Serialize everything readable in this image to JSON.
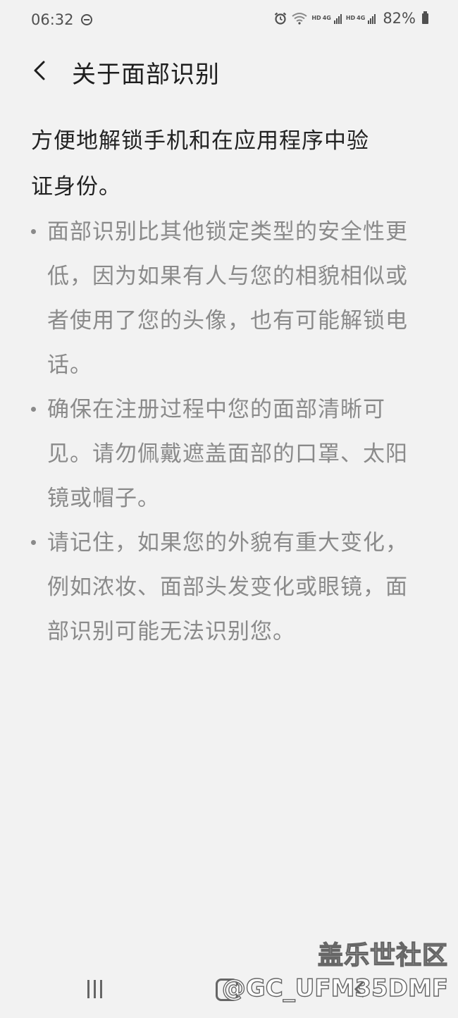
{
  "status_bar": {
    "time": "06:32",
    "network_1": "HD",
    "network_1_gen": "4G",
    "network_2": "HD",
    "network_2_gen": "4G",
    "battery": "82%",
    "icons": [
      "do-not-disturb-icon",
      "alarm-icon",
      "wifi-icon",
      "signal-icon",
      "battery-icon"
    ]
  },
  "header": {
    "title": "关于面部识别",
    "back_icon": "chevron-left-icon"
  },
  "content": {
    "intro_line1": "方便地解锁手机和在应用程序中验",
    "intro_line2": "证身份。",
    "bullets": [
      "面部识别比其他锁定类型的安全性更低，因为如果有人与您的相貌相似或者使用了您的头像，也有可能解锁电话。",
      "确保在注册过程中您的面部清晰可见。请勿佩戴遮盖面部的口罩、太阳镜或帽子。",
      "请记住，如果您的外貌有重大变化，例如浓妆、面部头发变化或眼镜，面部识别可能无法识别您。"
    ]
  },
  "watermark": {
    "title": "盖乐世社区",
    "handle": "@GC_UFM35DMF"
  },
  "nav_bar": {
    "icons": [
      "recent-apps-icon",
      "home-icon",
      "back-icon"
    ]
  },
  "colors": {
    "background": "#f2f2f2",
    "title_text": "#1e1e1e",
    "body_text": "#222222",
    "secondary_text": "#8a8a8a"
  }
}
